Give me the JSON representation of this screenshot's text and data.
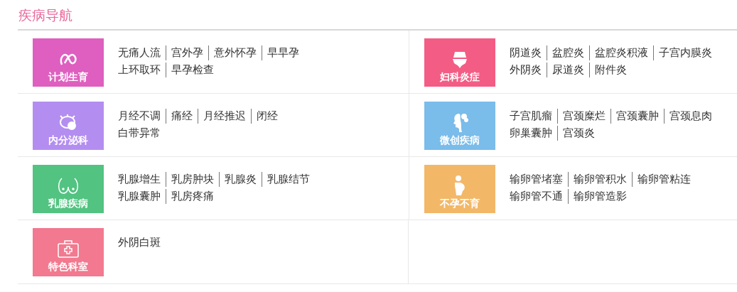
{
  "title": "疾病导航",
  "categories": [
    {
      "label": "计划生育",
      "color": "#de5fbf",
      "lines": [
        [
          "无痛人流",
          "宫外孕",
          "意外怀孕",
          "早早孕"
        ],
        [
          "上环取环",
          "早孕检查"
        ]
      ]
    },
    {
      "label": "妇科炎症",
      "color": "#f35c84",
      "lines": [
        [
          "阴道炎",
          "盆腔炎",
          "盆腔炎积液",
          "子宫内膜炎"
        ],
        [
          "外阴炎",
          "尿道炎",
          "附件炎"
        ]
      ]
    },
    {
      "label": "内分泌科",
      "color": "#b38ef0",
      "lines": [
        [
          "月经不调",
          "痛经",
          "月经推迟",
          "闭经"
        ],
        [
          "白带异常"
        ]
      ]
    },
    {
      "label": "微创疾病",
      "color": "#7abcea",
      "lines": [
        [
          "子宫肌瘤",
          "宫颈糜烂",
          "宫颈囊肿",
          "宫颈息肉"
        ],
        [
          "卵巢囊肿",
          "宫颈炎"
        ]
      ]
    },
    {
      "label": "乳腺疾病",
      "color": "#52c381",
      "lines": [
        [
          "乳腺增生",
          "乳房肿块",
          "乳腺炎",
          "乳腺结节"
        ],
        [
          "乳腺囊肿",
          "乳房疼痛"
        ]
      ]
    },
    {
      "label": "不孕不育",
      "color": "#f2b868",
      "lines": [
        [
          "输卵管堵塞",
          "输卵管积水",
          "输卵管粘连"
        ],
        [
          "输卵管不通",
          "输卵管造影"
        ]
      ]
    },
    {
      "label": "特色科室",
      "color": "#f2798f",
      "lines": [
        [
          "外阴白斑"
        ]
      ]
    }
  ]
}
